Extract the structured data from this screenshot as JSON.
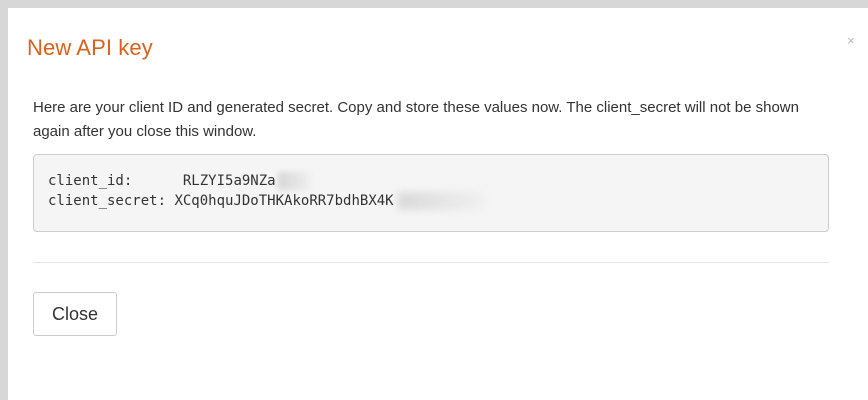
{
  "modal": {
    "title": "New API key",
    "close_icon_glyph": "×",
    "close_icon": "close-icon",
    "description": "Here are your client ID and generated secret. Copy and store these values now. The client_secret will not be shown again after you close this window.",
    "credentials": {
      "client_id_label": "client_id:",
      "client_id_value": "RLZYI5a9NZa",
      "client_secret_label": "client_secret:",
      "client_secret_value": "XCq0hquJDoTHKAkoRR7bdhBX4K"
    },
    "close_button_label": "Close"
  },
  "colors": {
    "title": "#d9621c",
    "backdrop": "#d7d7d7",
    "code_background": "#f5f5f5"
  }
}
